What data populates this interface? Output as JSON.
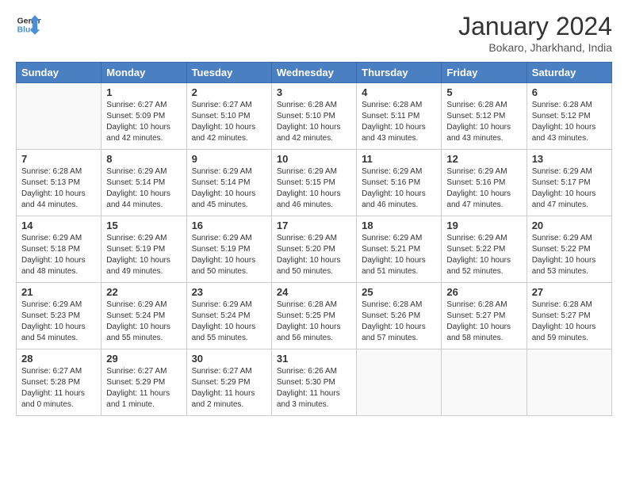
{
  "header": {
    "logo_line1": "General",
    "logo_line2": "Blue",
    "month_year": "January 2024",
    "location": "Bokaro, Jharkhand, India"
  },
  "weekdays": [
    "Sunday",
    "Monday",
    "Tuesday",
    "Wednesday",
    "Thursday",
    "Friday",
    "Saturday"
  ],
  "weeks": [
    [
      {
        "num": "",
        "info": ""
      },
      {
        "num": "1",
        "info": "Sunrise: 6:27 AM\nSunset: 5:09 PM\nDaylight: 10 hours\nand 42 minutes."
      },
      {
        "num": "2",
        "info": "Sunrise: 6:27 AM\nSunset: 5:10 PM\nDaylight: 10 hours\nand 42 minutes."
      },
      {
        "num": "3",
        "info": "Sunrise: 6:28 AM\nSunset: 5:10 PM\nDaylight: 10 hours\nand 42 minutes."
      },
      {
        "num": "4",
        "info": "Sunrise: 6:28 AM\nSunset: 5:11 PM\nDaylight: 10 hours\nand 43 minutes."
      },
      {
        "num": "5",
        "info": "Sunrise: 6:28 AM\nSunset: 5:12 PM\nDaylight: 10 hours\nand 43 minutes."
      },
      {
        "num": "6",
        "info": "Sunrise: 6:28 AM\nSunset: 5:12 PM\nDaylight: 10 hours\nand 43 minutes."
      }
    ],
    [
      {
        "num": "7",
        "info": "Sunrise: 6:28 AM\nSunset: 5:13 PM\nDaylight: 10 hours\nand 44 minutes."
      },
      {
        "num": "8",
        "info": "Sunrise: 6:29 AM\nSunset: 5:14 PM\nDaylight: 10 hours\nand 44 minutes."
      },
      {
        "num": "9",
        "info": "Sunrise: 6:29 AM\nSunset: 5:14 PM\nDaylight: 10 hours\nand 45 minutes."
      },
      {
        "num": "10",
        "info": "Sunrise: 6:29 AM\nSunset: 5:15 PM\nDaylight: 10 hours\nand 46 minutes."
      },
      {
        "num": "11",
        "info": "Sunrise: 6:29 AM\nSunset: 5:16 PM\nDaylight: 10 hours\nand 46 minutes."
      },
      {
        "num": "12",
        "info": "Sunrise: 6:29 AM\nSunset: 5:16 PM\nDaylight: 10 hours\nand 47 minutes."
      },
      {
        "num": "13",
        "info": "Sunrise: 6:29 AM\nSunset: 5:17 PM\nDaylight: 10 hours\nand 47 minutes."
      }
    ],
    [
      {
        "num": "14",
        "info": "Sunrise: 6:29 AM\nSunset: 5:18 PM\nDaylight: 10 hours\nand 48 minutes."
      },
      {
        "num": "15",
        "info": "Sunrise: 6:29 AM\nSunset: 5:19 PM\nDaylight: 10 hours\nand 49 minutes."
      },
      {
        "num": "16",
        "info": "Sunrise: 6:29 AM\nSunset: 5:19 PM\nDaylight: 10 hours\nand 50 minutes."
      },
      {
        "num": "17",
        "info": "Sunrise: 6:29 AM\nSunset: 5:20 PM\nDaylight: 10 hours\nand 50 minutes."
      },
      {
        "num": "18",
        "info": "Sunrise: 6:29 AM\nSunset: 5:21 PM\nDaylight: 10 hours\nand 51 minutes."
      },
      {
        "num": "19",
        "info": "Sunrise: 6:29 AM\nSunset: 5:22 PM\nDaylight: 10 hours\nand 52 minutes."
      },
      {
        "num": "20",
        "info": "Sunrise: 6:29 AM\nSunset: 5:22 PM\nDaylight: 10 hours\nand 53 minutes."
      }
    ],
    [
      {
        "num": "21",
        "info": "Sunrise: 6:29 AM\nSunset: 5:23 PM\nDaylight: 10 hours\nand 54 minutes."
      },
      {
        "num": "22",
        "info": "Sunrise: 6:29 AM\nSunset: 5:24 PM\nDaylight: 10 hours\nand 55 minutes."
      },
      {
        "num": "23",
        "info": "Sunrise: 6:29 AM\nSunset: 5:24 PM\nDaylight: 10 hours\nand 55 minutes."
      },
      {
        "num": "24",
        "info": "Sunrise: 6:28 AM\nSunset: 5:25 PM\nDaylight: 10 hours\nand 56 minutes."
      },
      {
        "num": "25",
        "info": "Sunrise: 6:28 AM\nSunset: 5:26 PM\nDaylight: 10 hours\nand 57 minutes."
      },
      {
        "num": "26",
        "info": "Sunrise: 6:28 AM\nSunset: 5:27 PM\nDaylight: 10 hours\nand 58 minutes."
      },
      {
        "num": "27",
        "info": "Sunrise: 6:28 AM\nSunset: 5:27 PM\nDaylight: 10 hours\nand 59 minutes."
      }
    ],
    [
      {
        "num": "28",
        "info": "Sunrise: 6:27 AM\nSunset: 5:28 PM\nDaylight: 11 hours\nand 0 minutes."
      },
      {
        "num": "29",
        "info": "Sunrise: 6:27 AM\nSunset: 5:29 PM\nDaylight: 11 hours\nand 1 minute."
      },
      {
        "num": "30",
        "info": "Sunrise: 6:27 AM\nSunset: 5:29 PM\nDaylight: 11 hours\nand 2 minutes."
      },
      {
        "num": "31",
        "info": "Sunrise: 6:26 AM\nSunset: 5:30 PM\nDaylight: 11 hours\nand 3 minutes."
      },
      {
        "num": "",
        "info": ""
      },
      {
        "num": "",
        "info": ""
      },
      {
        "num": "",
        "info": ""
      }
    ]
  ]
}
